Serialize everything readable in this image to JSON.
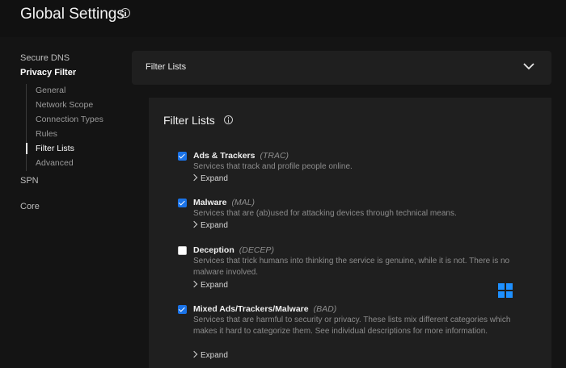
{
  "header": {
    "title": "Global Settings",
    "info_icon": "info-circle-icon"
  },
  "sidebar": {
    "items": [
      {
        "label": "Secure DNS"
      },
      {
        "label": "Privacy Filter"
      },
      {
        "label": "SPN"
      },
      {
        "label": "Core"
      }
    ],
    "subitems": [
      {
        "label": "General"
      },
      {
        "label": "Network Scope"
      },
      {
        "label": "Connection Types"
      },
      {
        "label": "Rules"
      },
      {
        "label": "Filter Lists"
      },
      {
        "label": "Advanced"
      }
    ],
    "active_section": "Privacy Filter",
    "active_subitem": "Filter Lists"
  },
  "accordion": {
    "label": "Filter Lists",
    "icon": "chevron-down-icon"
  },
  "panel": {
    "title": "Filter Lists",
    "info_icon": "info-circle-icon",
    "items": [
      {
        "name": "Ads & Trackers",
        "code": "(TRAC)",
        "checked": true,
        "desc": "Services that track and profile people online.",
        "expand": "Expand"
      },
      {
        "name": "Malware",
        "code": "(MAL)",
        "checked": true,
        "desc": "Services that are (ab)used for attacking devices through technical means.",
        "expand": "Expand"
      },
      {
        "name": "Deception",
        "code": "(DECEP)",
        "checked": false,
        "desc": "Services that trick humans into thinking the service is genuine, while it is not. There is no malware involved.",
        "expand": "Expand"
      },
      {
        "name": "Mixed Ads/Trackers/Malware",
        "code": "(BAD)",
        "checked": true,
        "desc": "Services that are harmful to security or privacy. These lists mix different categories which makes it hard to categorize them. See individual descriptions for more information.",
        "expand": "Expand"
      }
    ]
  },
  "colors": {
    "accent": "#1a73e8",
    "background": "#141414",
    "panel": "#1f1f1f"
  },
  "watermark": {
    "icon": "windows-logo-icon"
  }
}
